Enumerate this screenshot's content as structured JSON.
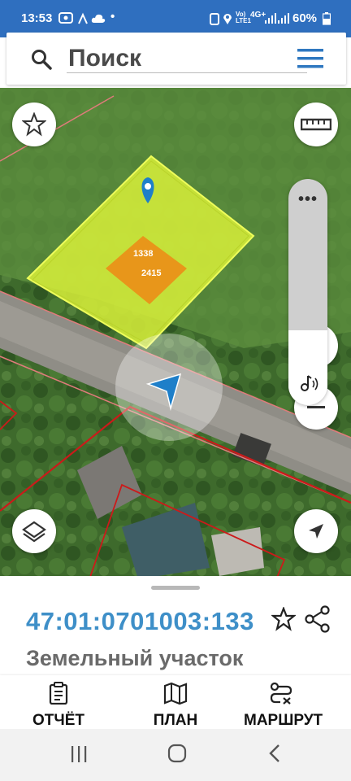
{
  "status_bar": {
    "time": "13:53",
    "network": "4G+",
    "battery": "60%"
  },
  "search": {
    "placeholder": "Поиск"
  },
  "map": {
    "parcel_label_1": "1338",
    "parcel_label_2": "2415"
  },
  "sheet": {
    "cadastral_number": "47:01:0701003:133",
    "property_type": "Земельный участок"
  },
  "actions": {
    "report": "ОТЧЁТ",
    "plan": "ПЛАН",
    "route": "МАРШРУТ"
  },
  "colors": {
    "accent": "#3e8fc8",
    "status_bar": "#2f6fbf",
    "parcel_fill": "#d8f03a",
    "parcel_inner": "#e8961a"
  }
}
